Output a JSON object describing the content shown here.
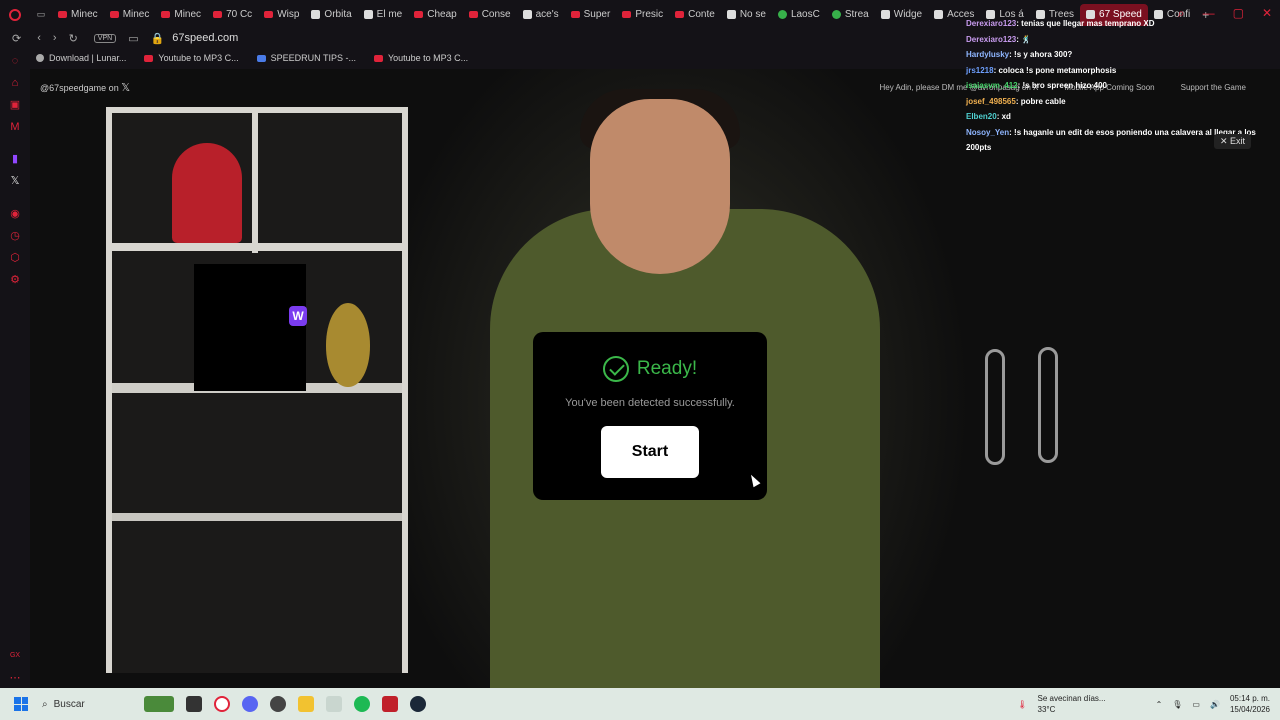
{
  "tabs": [
    {
      "label": "Minec",
      "icon": "youtube-icon"
    },
    {
      "label": "Minec",
      "icon": "youtube-icon"
    },
    {
      "label": "Minec",
      "icon": "youtube-icon"
    },
    {
      "label": "70 Cc",
      "icon": "youtube-icon"
    },
    {
      "label": "Wisp",
      "icon": "youtube-icon"
    },
    {
      "label": "Orbita",
      "icon": "site-icon"
    },
    {
      "label": "El me",
      "icon": "site-icon"
    },
    {
      "label": "Cheap",
      "icon": "youtube-icon"
    },
    {
      "label": "Conse",
      "icon": "youtube-icon"
    },
    {
      "label": "ace's",
      "icon": "site-icon"
    },
    {
      "label": "Super",
      "icon": "youtube-icon"
    },
    {
      "label": "Presic",
      "icon": "youtube-icon"
    },
    {
      "label": "Conte",
      "icon": "youtube-icon"
    },
    {
      "label": "No se",
      "icon": "drive-icon"
    },
    {
      "label": "LaosC",
      "icon": "kick-icon"
    },
    {
      "label": "Strea",
      "icon": "kick-icon"
    },
    {
      "label": "Widge",
      "icon": "site-icon"
    },
    {
      "label": "Acces",
      "icon": "grid-icon"
    },
    {
      "label": "Los á",
      "icon": "site-icon"
    },
    {
      "label": "Trees",
      "icon": "site-icon"
    },
    {
      "label": "67 Speed",
      "icon": "site-icon",
      "active": true
    },
    {
      "label": "Confi",
      "icon": "gear-icon"
    }
  ],
  "address": {
    "url": "67speed.com",
    "vpn": "VPN"
  },
  "bookmarks": [
    {
      "label": "Download | Lunar...",
      "icon": "lunar"
    },
    {
      "label": "Youtube to MP3 C...",
      "icon": "yt"
    },
    {
      "label": "SPEEDRUN TIPS -...",
      "icon": "doc"
    },
    {
      "label": "Youtube to MP3 C...",
      "icon": "yt"
    }
  ],
  "page_header": {
    "handle": "@67speedgame on",
    "dm_note": "Hey Adin, please DM me @avronpasag on X",
    "mobile": "Mobile App Coming Soon",
    "support": "Support the Game"
  },
  "chat": [
    {
      "user": "Derexiaro123",
      "color": "#c99cf0",
      "msg": ": tenias que llegar mas temprano XD"
    },
    {
      "user": "Derexiaro123",
      "color": "#c99cf0",
      "msg": ": 🕺"
    },
    {
      "user": "Hardylusky",
      "color": "#8fb6ff",
      "msg": ": !s y ahora 300?"
    },
    {
      "user": "jrs1218",
      "color": "#6fa0ff",
      "msg": ": coloca !s pone metamorphosis"
    },
    {
      "user": "isaiasvm_412",
      "color": "#46d26a",
      "msg": ": !s bro spreen hizo 400"
    },
    {
      "user": "josef_498565",
      "color": "#f0b050",
      "msg": ": pobre cable"
    },
    {
      "user": "Elben20",
      "color": "#4fd0d0",
      "msg": ": xd"
    },
    {
      "user": "Nosoy_Yen",
      "color": "#8fb6ff",
      "msg": ": !s haganle un edit de esos poniendo una calavera al llegar a los 200pts"
    }
  ],
  "exit_label": "Exit",
  "modal": {
    "title": "Ready!",
    "subtitle": "You've been detected successfully.",
    "button": "Start"
  },
  "taskbar": {
    "search": "Buscar",
    "weather": "Se avecinan días...",
    "temp": "33°C",
    "time": "05:14 p. m.",
    "date": "15/04/2026"
  },
  "colors": {
    "accent": "#e0233a",
    "ready_green": "#3bb84a"
  }
}
